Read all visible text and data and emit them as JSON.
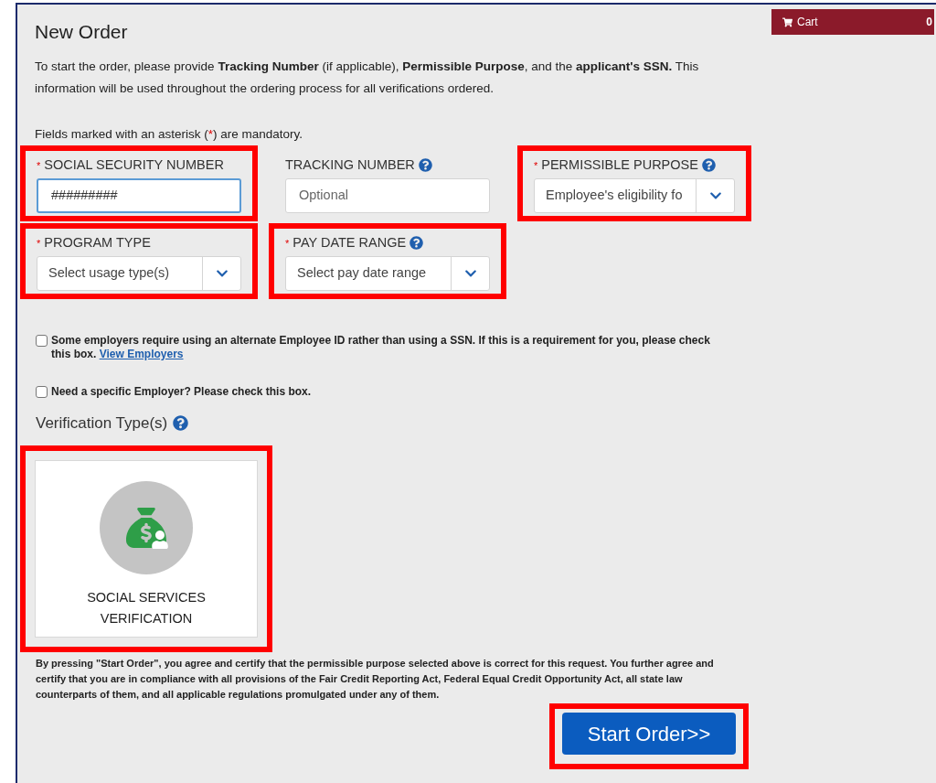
{
  "title": "New Order",
  "intro": "To start the order, please provide **Tracking Number** (if applicable), **Permissible Purpose**, and the **applicant's SSN.** This information will be used throughout the ordering process for all verifications ordered.",
  "mandatory_note": {
    "before": "Fields marked with an asterisk (",
    "mark": "*",
    "after": ") are mandatory."
  },
  "cart": {
    "label": "Cart",
    "count": "0"
  },
  "fields": [
    {
      "kind": "input",
      "label": "SOCIAL SECURITY NUMBER",
      "required_mark": "*",
      "help": false,
      "value": "#########",
      "focused": true,
      "highlighted": true
    },
    {
      "kind": "input",
      "label": "TRACKING NUMBER",
      "help": true,
      "placeholder": "Optional",
      "focused": false,
      "highlighted": false
    },
    {
      "kind": "select",
      "label": "PERMISSIBLE PURPOSE",
      "required_mark": "*",
      "help": true,
      "value": "Employee's eligibility fo",
      "highlighted": true
    },
    {
      "kind": "select",
      "label": "PROGRAM TYPE",
      "required_mark": "*",
      "help": false,
      "placeholder": "Select usage type(s)",
      "highlighted": true
    },
    {
      "kind": "select",
      "label": "PAY DATE RANGE",
      "required_mark": "*",
      "help": true,
      "placeholder": "Select pay date range",
      "highlighted": true
    }
  ],
  "checkboxes": [
    {
      "text": "Some employers require using an alternate Employee ID rather than using a SSN. If this is a requirement for you, please check this box.",
      "link": "View Employers",
      "checked": false
    },
    {
      "text": "Need a specific Employer? Please check this box.",
      "checked": false
    }
  ],
  "verification": {
    "heading": "Verification Type(s)",
    "tiles": [
      {
        "label": "SOCIAL SERVICES VERIFICATION",
        "highlighted": true
      }
    ]
  },
  "disclaimer": "By pressing \"Start Order\", you agree and certify that the permissible purpose selected above is correct for this request. You further agree and certify that you are in compliance with all provisions of the Fair Credit Reporting Act, Federal Equal Credit Opportunity Act, all state law counterparts of them, and all applicable regulations promulgated under any of them.",
  "start_button": {
    "label": "Start Order>>",
    "highlighted": true
  }
}
